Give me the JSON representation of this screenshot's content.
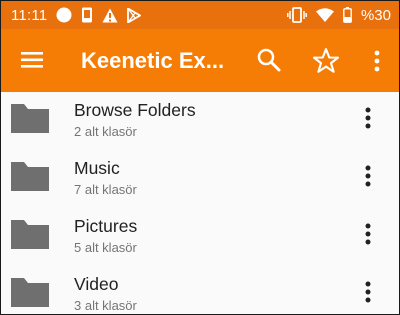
{
  "status_bar": {
    "time": "11:11",
    "battery_text": "%30"
  },
  "app_bar": {
    "title": "Keenetic Ex..."
  },
  "folders": [
    {
      "name": "Browse Folders",
      "subtitle": "2 alt klasör"
    },
    {
      "name": "Music",
      "subtitle": "7 alt klasör"
    },
    {
      "name": "Pictures",
      "subtitle": "5 alt klasör"
    },
    {
      "name": "Video",
      "subtitle": "3 alt klasör"
    }
  ],
  "colors": {
    "status_bar": "#e8710e",
    "app_bar": "#f57d05",
    "folder_icon": "#6f6f6f"
  },
  "icons": [
    "circle-icon",
    "phone-icon",
    "warning-icon",
    "play-store-icon",
    "vibrate-icon",
    "wifi-icon",
    "battery-icon",
    "menu-icon",
    "search-icon",
    "star-icon",
    "more-vert-icon",
    "folder-icon"
  ]
}
